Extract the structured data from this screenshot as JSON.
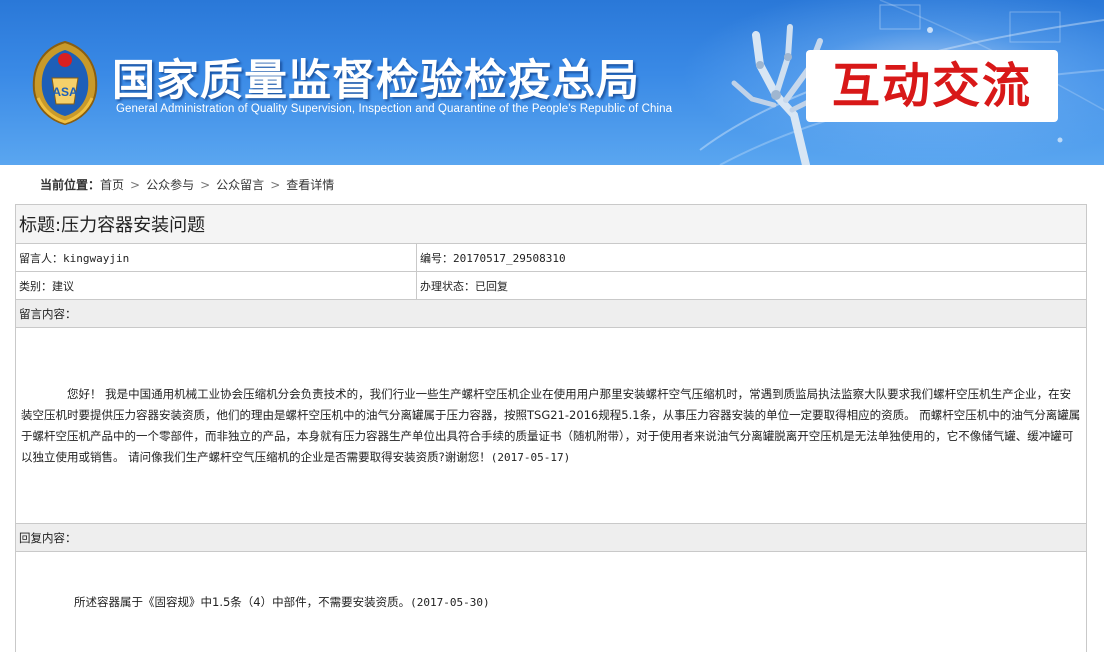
{
  "banner": {
    "title_cn": "国家质量监督检验检疫总局",
    "title_en": "General Administration of Quality Supervision, Inspection and Quarantine of the People's Republic of China",
    "section_label": "互动交流",
    "accent_color": "#d81818",
    "bg_color": "#2a78d8"
  },
  "breadcrumb": {
    "lead": "当前位置：",
    "items": [
      "首页",
      "公众参与",
      "公众留言",
      "查看详情"
    ],
    "separator": ">"
  },
  "detail": {
    "title": "标题:压力容器安装问题",
    "author_label": "留言人：",
    "author": "kingwayjin",
    "number_label": "编号：",
    "number": "20170517_29508310",
    "category_label": "类别：",
    "category": "建议",
    "status_label": "办理状态：",
    "status": "已回复",
    "message_header": "留言内容：",
    "message": "您好！ 我是中国通用机械工业协会压缩机分会负责技术的，我们行业一些生产螺杆空压机企业在使用用户那里安装螺杆空气压缩机时，常遇到质监局执法监察大队要求我们螺杆空压机生产企业，在安装空压机时要提供压力容器安装资质，他们的理由是螺杆空压机中的油气分离罐属于压力容器，按照TSG21-2016规程5.1条，从事压力容器安装的单位一定要取得相应的资质。 而螺杆空压机中的油气分离罐属于螺杆空压机产品中的一个零部件，而非独立的产品，本身就有压力容器生产单位出具符合手续的质量证书（随机附带），对于使用者来说油气分离罐脱离开空压机是无法单独使用的，它不像储气罐、缓冲罐可以独立使用或销售。 请问像我们生产螺杆空气压缩机的企业是否需要取得安装资质?谢谢您！",
    "message_date": "(2017-05-17)",
    "reply_header": "回复内容：",
    "reply": "所述容器属于《固容规》中1.5条（4）中部件，不需要安装资质。",
    "reply_date": "(2017-05-30)"
  }
}
